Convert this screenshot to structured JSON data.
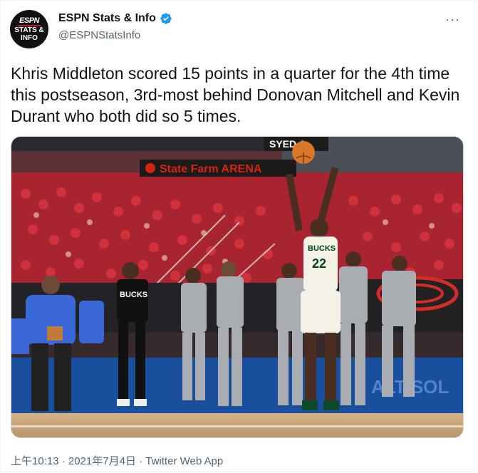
{
  "tweet": {
    "author_name": "ESPN Stats & Info",
    "author_handle": "@ESPNStatsInfo",
    "avatar_text": {
      "brand": "ESPN",
      "line1": "STATS &",
      "line2": "INFO"
    },
    "more_label": "···",
    "text": "Khris Middleton scored 15 points in a quarter for the 4th time this postseason, 3rd-most behind Donovan Mitchell and Kevin Durant who both did so 5 times.",
    "timestamp": "上午10:13 · 2021年7月4日",
    "separator": " · ",
    "source_app": "Twitter Web App"
  },
  "media": {
    "arena_sign": "State Farm ARENA",
    "top_sign": "SYED A",
    "jersey_team": "BUCKS",
    "jersey_number": "22",
    "bench_jersey": "BUCKS",
    "banner_text": "ALT SOL"
  },
  "colors": {
    "verified": "#1d9bf0",
    "crowd_red": "#c4202a",
    "court": "#c9a97a",
    "bucks_green": "#00471b"
  }
}
